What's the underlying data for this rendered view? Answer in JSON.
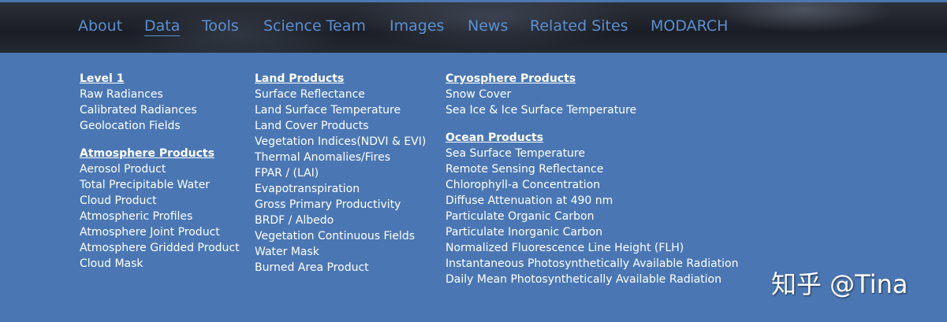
{
  "nav": {
    "items": [
      {
        "label": "About"
      },
      {
        "label": "Data"
      },
      {
        "label": "Tools"
      },
      {
        "label": "Science Team"
      },
      {
        "label": "Images"
      },
      {
        "label": "News"
      },
      {
        "label": "Related Sites"
      },
      {
        "label": "MODARCH"
      }
    ],
    "active": "Data",
    "link_color": "#5b8fd1"
  },
  "menu": {
    "level1": {
      "heading": "Level 1",
      "links": [
        "Raw Radiances",
        "Calibrated Radiances",
        "Geolocation Fields"
      ]
    },
    "atmosphere": {
      "heading": "Atmosphere Products",
      "links": [
        "Aerosol Product",
        "Total Precipitable Water",
        "Cloud Product",
        "Atmospheric Profiles",
        "Atmosphere Joint Product",
        "Atmosphere Gridded Product",
        "Cloud Mask"
      ]
    },
    "land": {
      "heading": "Land Products",
      "links": [
        "Surface Reflectance",
        "Land Surface Temperature",
        "Land Cover Products",
        "Vegetation Indices(NDVI & EVI)",
        "Thermal Anomalies/Fires",
        "FPAR / (LAI)",
        "Evapotranspiration",
        "Gross Primary Productivity",
        "BRDF / Albedo",
        "Vegetation Continuous Fields",
        "Water Mask",
        "Burned Area Product"
      ]
    },
    "cryosphere": {
      "heading": "Cryosphere Products",
      "links": [
        "Snow Cover",
        "Sea Ice & Ice Surface Temperature"
      ]
    },
    "ocean": {
      "heading": "Ocean Products",
      "links": [
        "Sea Surface Temperature",
        "Remote Sensing Reflectance",
        "Chlorophyll-a Concentration",
        "Diffuse Attenuation at 490 nm",
        "Particulate Organic Carbon",
        "Particulate Inorganic Carbon",
        "Normalized Fluorescence Line Height (FLH)",
        "Instantaneous Photosynthetically Available Radiation",
        "Daily Mean Photosynthetically Available Radiation"
      ]
    },
    "background_color": "#4a77b3"
  },
  "watermark": "知乎 @Tina"
}
